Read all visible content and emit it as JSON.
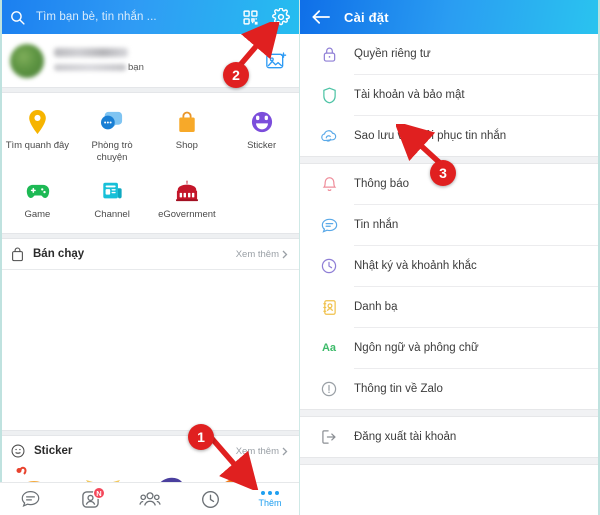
{
  "left_phone": {
    "search": {
      "placeholder": "Tìm bạn bè, tin nhắn ...",
      "search_icon": "search-icon",
      "qr_icon": "qr-code-icon",
      "settings_icon": "gear-icon"
    },
    "profile": {
      "name_redacted": "",
      "subtitle_suffix": "bạn",
      "photo_icon": "add-photo-icon"
    },
    "shortcuts": [
      {
        "label": "Tìm quanh đây",
        "icon": "location-pin-icon",
        "color": "#f6b400"
      },
      {
        "label": "Phòng trò chuyện",
        "icon": "chat-bubbles-icon",
        "color": "#2f8fe0"
      },
      {
        "label": "Shop",
        "icon": "shopping-bag-icon",
        "color": "#f5a623"
      },
      {
        "label": "Sticker",
        "icon": "smiley-sticker-icon",
        "color": "#7b4ddb"
      },
      {
        "label": "Game",
        "icon": "gamepad-icon",
        "color": "#1db954"
      },
      {
        "label": "Channel",
        "icon": "news-channel-icon",
        "color": "#17c0d8"
      },
      {
        "label": "eGovernment",
        "icon": "government-building-icon",
        "color": "#c4162a"
      }
    ],
    "sections": [
      {
        "title": "Bán chạy",
        "icon": "shopping-bag-outline-icon",
        "more_label": "Xem thêm"
      },
      {
        "title": "Sticker",
        "icon": "smiley-outline-icon",
        "more_label": "Xem thêm"
      }
    ],
    "bottom_nav": [
      {
        "label": "",
        "icon": "message-bubble-icon",
        "badge": "",
        "active": false
      },
      {
        "label": "",
        "icon": "contacts-icon",
        "badge": "N",
        "active": false
      },
      {
        "label": "",
        "icon": "group-people-icon",
        "badge": "",
        "active": false
      },
      {
        "label": "",
        "icon": "clock-timeline-icon",
        "badge": "",
        "active": false
      },
      {
        "label": "Thêm",
        "icon": "more-dots-icon",
        "badge": "",
        "active": true
      }
    ]
  },
  "right_phone": {
    "header": {
      "title": "Cài đặt",
      "back_icon": "back-arrow-icon"
    },
    "settings_groups": [
      {
        "items": [
          {
            "label": "Quyền riêng tư",
            "icon": "lock-icon",
            "color": "#8f7fd6"
          },
          {
            "label": "Tài khoản và bảo mật",
            "icon": "shield-icon",
            "color": "#4dc3a5"
          },
          {
            "label": "Sao lưu và khôi phục tin nhắn",
            "icon": "cloud-sync-icon",
            "color": "#5aa9e8"
          }
        ]
      },
      {
        "items": [
          {
            "label": "Thông báo",
            "icon": "bell-icon",
            "color": "#ef8e9b"
          },
          {
            "label": "Tin nhắn",
            "icon": "message-bubble-icon",
            "color": "#5aa9e8"
          },
          {
            "label": "Nhật ký và khoảnh khắc",
            "icon": "clock-timeline-icon",
            "color": "#8f7fd6"
          },
          {
            "label": "Danh bạ",
            "icon": "contacts-book-icon",
            "color": "#f0c14b"
          },
          {
            "label": "Ngôn ngữ và phông chữ",
            "icon": "font-size-icon",
            "color": "#3dbb6a"
          },
          {
            "label": "Thông tin về Zalo",
            "icon": "info-icon",
            "color": "#9aa0a6"
          }
        ]
      },
      {
        "items": [
          {
            "label": "Đăng xuất tài khoản",
            "icon": "logout-icon",
            "color": "#8b8f94"
          }
        ]
      }
    ]
  },
  "annotations": [
    {
      "number": "1",
      "target": "more-tab-bottom-nav"
    },
    {
      "number": "2",
      "target": "gear-icon-settings"
    },
    {
      "number": "3",
      "target": "backup-restore-messages-row"
    }
  ],
  "colors": {
    "header_blue_start": "#1b7ff0",
    "header_cyan_end": "#26bdf0",
    "accent": "#1f9ff0",
    "annotation_red": "#e02020",
    "badge_red": "#f4475a"
  }
}
